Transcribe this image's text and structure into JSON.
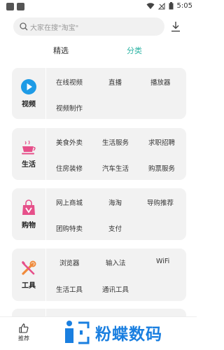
{
  "status_bar": {
    "time": "5:05"
  },
  "search": {
    "placeholder": "大家在搜\"淘宝\""
  },
  "tabs": [
    {
      "label": "精选"
    },
    {
      "label": "分类",
      "active": true
    }
  ],
  "categories": [
    {
      "name": "视频",
      "icon": "play-icon",
      "items": [
        "在线视频",
        "直播",
        "播放器",
        "视频制作"
      ]
    },
    {
      "name": "生活",
      "icon": "cup-icon",
      "items": [
        "美食外卖",
        "生活服务",
        "求职招聘",
        "住房装修",
        "汽车生活",
        "购票服务"
      ]
    },
    {
      "name": "购物",
      "icon": "shopping-bag-icon",
      "items": [
        "网上商城",
        "海淘",
        "导购推荐",
        "团购特卖",
        "支付"
      ]
    },
    {
      "name": "工具",
      "icon": "tools-icon",
      "items": [
        "浏览器",
        "输入法",
        "WiFi",
        "生活工具",
        "通讯工具"
      ]
    }
  ],
  "bottom_nav": {
    "recommend_label": "推荐"
  },
  "watermark": {
    "text": "粉蝶数码"
  },
  "colors": {
    "accent": "#2bb3a3",
    "card_bg": "#f2f2f2",
    "watermark": "#1a7fe0"
  }
}
